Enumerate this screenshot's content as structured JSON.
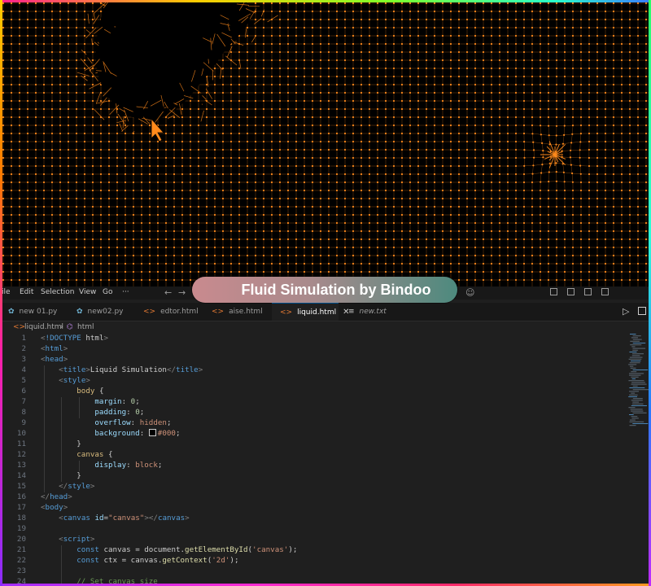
{
  "overlay": {
    "title": "Fluid Simulation by Bindoo"
  },
  "menu": [
    "ile",
    "Edit",
    "Selection",
    "View",
    "Go",
    "···"
  ],
  "tabs": [
    {
      "label": "new 01.py",
      "type": "py",
      "active": false
    },
    {
      "label": "new02.py",
      "type": "py",
      "active": false
    },
    {
      "label": "edtor.html",
      "type": "html",
      "active": false
    },
    {
      "label": "aise.html",
      "type": "html",
      "active": false
    },
    {
      "label": "liquid.html",
      "type": "html",
      "active": true
    },
    {
      "label": "new.txt",
      "type": "txt",
      "active": false
    }
  ],
  "breadcrumb": {
    "file": "liquid.html",
    "symbol": "html"
  },
  "colors": {
    "grid": "#ff8a1c",
    "accent": "#0078d4",
    "editor_bg": "#1f1f1f"
  },
  "icons": {
    "cursor": "orange-pointer-icon",
    "close": "close-icon",
    "run": "play-icon",
    "split": "split-editor-icon"
  },
  "code": [
    {
      "n": "1",
      "t": "<!DOCTYPE html>"
    },
    {
      "n": "2",
      "t": "<html>"
    },
    {
      "n": "3",
      "t": "<head>"
    },
    {
      "n": "4",
      "t": "    <title>Liquid Simulation</title>"
    },
    {
      "n": "5",
      "t": "    <style>"
    },
    {
      "n": "6",
      "t": "        body {"
    },
    {
      "n": "7",
      "t": "            margin: 0;"
    },
    {
      "n": "8",
      "t": "            padding: 0;"
    },
    {
      "n": "9",
      "t": "            overflow: hidden;"
    },
    {
      "n": "10",
      "t": "            background: #000;"
    },
    {
      "n": "11",
      "t": "        }"
    },
    {
      "n": "12",
      "t": "        canvas {"
    },
    {
      "n": "13",
      "t": "            display: block;"
    },
    {
      "n": "14",
      "t": "        }"
    },
    {
      "n": "15",
      "t": "    </style>"
    },
    {
      "n": "16",
      "t": "</head>"
    },
    {
      "n": "17",
      "t": "<body>"
    },
    {
      "n": "18",
      "t": "    <canvas id=\"canvas\"></canvas>"
    },
    {
      "n": "19",
      "t": ""
    },
    {
      "n": "20",
      "t": "    <script>"
    },
    {
      "n": "21",
      "t": "        const canvas = document.getElementById('canvas');"
    },
    {
      "n": "22",
      "t": "        const ctx = canvas.getContext('2d');"
    },
    {
      "n": "23",
      "t": ""
    },
    {
      "n": "24",
      "t": "        // Set canvas size"
    }
  ]
}
